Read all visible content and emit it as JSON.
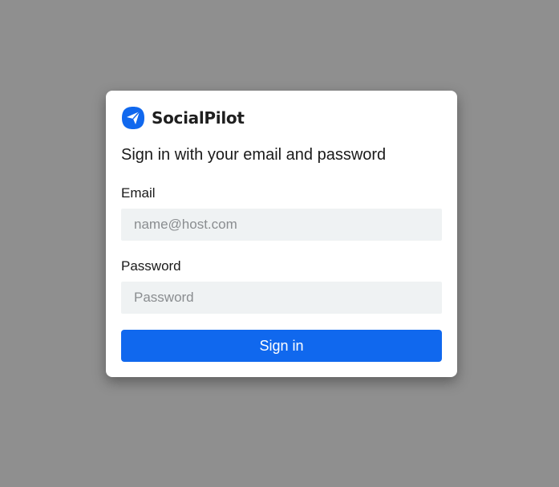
{
  "brand": {
    "name": "SocialPilot",
    "icon": "paper-plane-icon",
    "icon_color": "#1068ee"
  },
  "signin_form": {
    "heading": "Sign in with your email and password",
    "email": {
      "label": "Email",
      "placeholder": "name@host.com",
      "value": ""
    },
    "password": {
      "label": "Password",
      "placeholder": "Password",
      "value": ""
    },
    "submit_label": "Sign in"
  },
  "colors": {
    "backdrop": "#8f8f8f",
    "card": "#ffffff",
    "input_background": "#eff2f3",
    "primary_button": "#1068ee"
  }
}
